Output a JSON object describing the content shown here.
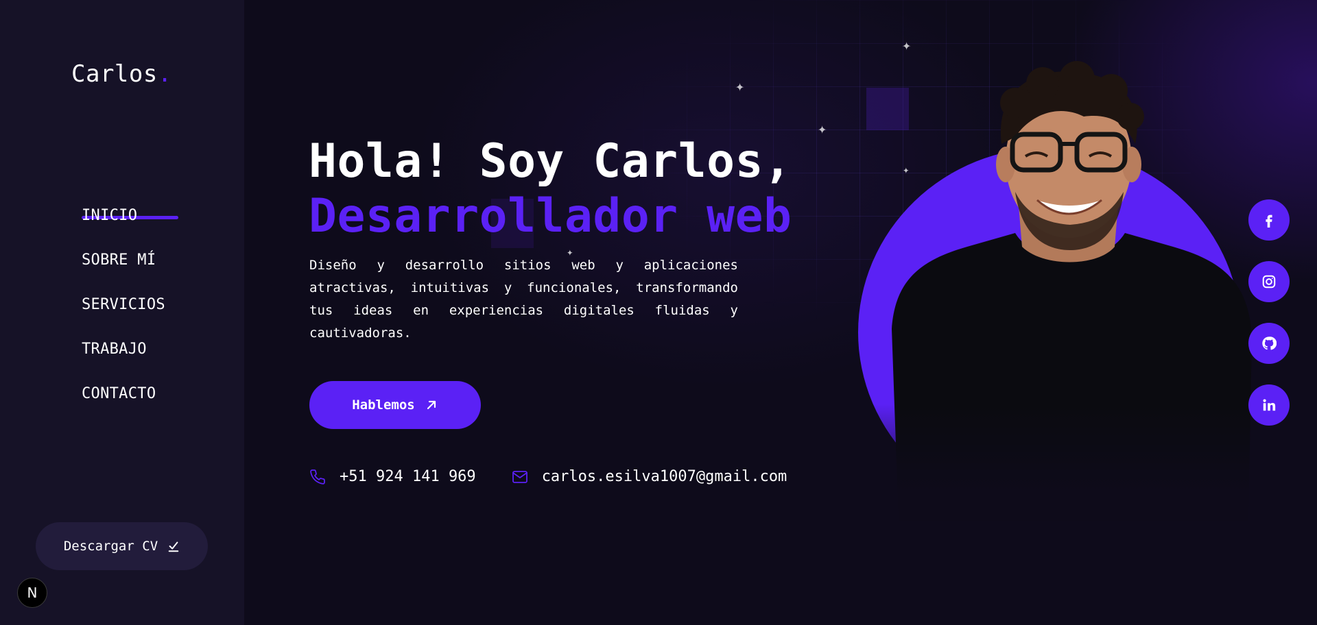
{
  "brand": {
    "name": "Carlos",
    "dot": ".",
    "accent_color": "#5b21f5"
  },
  "nav": {
    "items": [
      {
        "label": "INICIO",
        "active": true
      },
      {
        "label": "SOBRE MÍ",
        "active": false
      },
      {
        "label": "SERVICIOS",
        "active": false
      },
      {
        "label": "TRABAJO",
        "active": false
      },
      {
        "label": "CONTACTO",
        "active": false
      }
    ]
  },
  "sidebar": {
    "cv_button_label": "Descargar CV",
    "cv_icon": "check-icon",
    "badge_label": "N"
  },
  "hero": {
    "title_line1": "Hola! Soy Carlos,",
    "title_line2": "Desarrollador web",
    "description": "Diseño y desarrollo sitios web y aplicaciones atractivas, intuitivas y funcionales, transformando tus ideas en experiencias digitales fluidas y cautivadoras.",
    "cta_label": "Hablemos",
    "cta_icon": "arrow-up-right-icon"
  },
  "contact": {
    "phone": "+51 924 141 969",
    "phone_icon": "phone-icon",
    "email": "carlos.esilva1007@gmail.com",
    "email_icon": "mail-icon"
  },
  "social": [
    {
      "name": "facebook",
      "icon": "facebook-icon"
    },
    {
      "name": "instagram",
      "icon": "instagram-icon"
    },
    {
      "name": "github",
      "icon": "github-icon"
    },
    {
      "name": "linkedin",
      "icon": "linkedin-icon"
    }
  ],
  "colors": {
    "background": "#0e0b1b",
    "sidebar": "#161227",
    "accent": "#5b21f5",
    "button_dark": "#221c3b"
  }
}
